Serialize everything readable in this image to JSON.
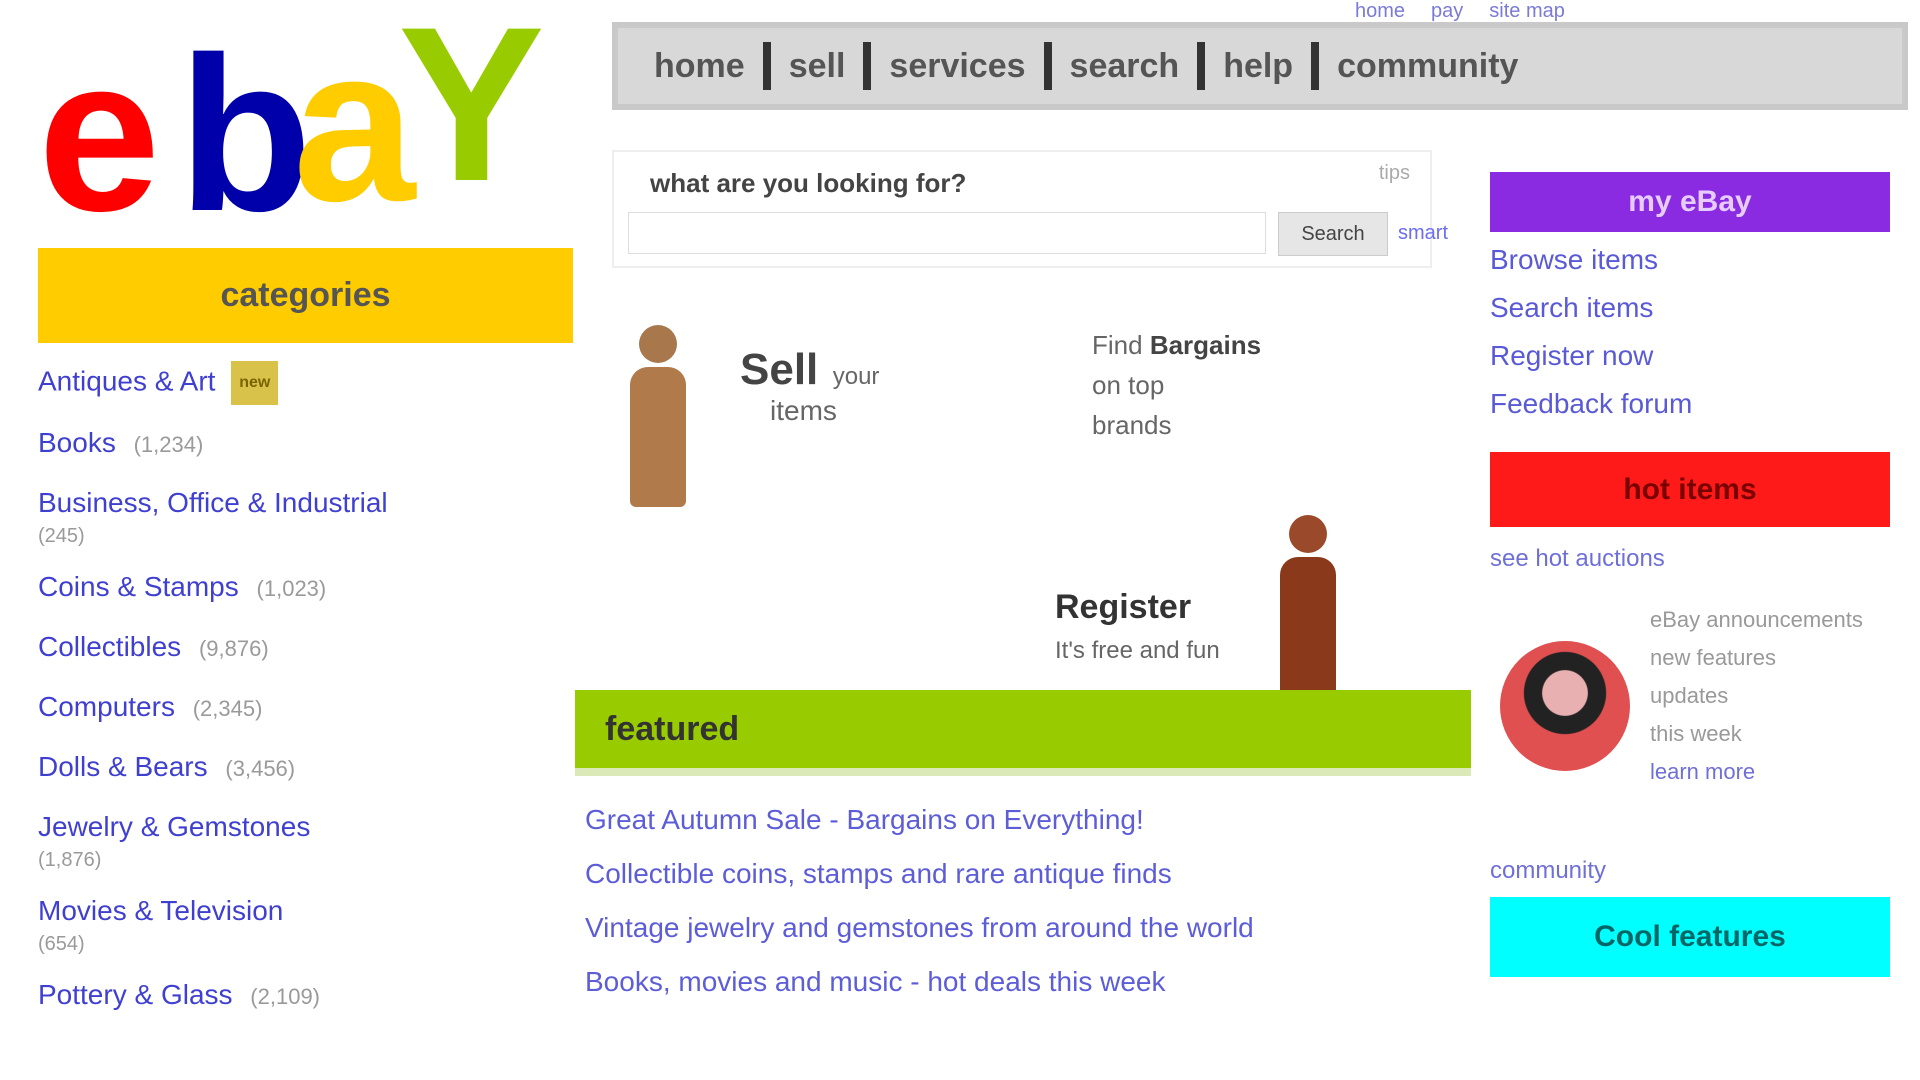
{
  "brand": {
    "logo_text": "ebay"
  },
  "utility_links": [
    "home",
    "pay",
    "site map"
  ],
  "nav": {
    "items": [
      "home",
      "sell",
      "services",
      "search",
      "help",
      "community"
    ]
  },
  "left": {
    "category_header": "categories",
    "categories": [
      {
        "label": "Antiques & Art",
        "badge": "new",
        "count": "",
        "sub": ""
      },
      {
        "label": "Books",
        "badge": "",
        "count": "(1,234)",
        "sub": ""
      },
      {
        "label": "Business, Office & Industrial",
        "badge": "",
        "count": "",
        "sub": "(245)"
      },
      {
        "label": "Coins & Stamps",
        "badge": "",
        "count": "(1,023)",
        "sub": ""
      },
      {
        "label": "Collectibles",
        "badge": "",
        "count": "(9,876)",
        "sub": ""
      },
      {
        "label": "Computers",
        "badge": "",
        "count": "(2,345)",
        "sub": ""
      },
      {
        "label": "Dolls & Bears",
        "badge": "",
        "count": "(3,456)",
        "sub": ""
      },
      {
        "label": "Jewelry & Gemstones",
        "badge": "",
        "count": "",
        "sub": "(1,876)"
      },
      {
        "label": "Movies & Television",
        "badge": "",
        "count": "",
        "sub": "(654)"
      },
      {
        "label": "Pottery & Glass",
        "badge": "",
        "count": "(2,109)",
        "sub": ""
      }
    ]
  },
  "search": {
    "label": "what are you looking for?",
    "help": "tips",
    "placeholder": "",
    "button": "Search",
    "advanced": "smart"
  },
  "promo": {
    "p1_title": "Sell",
    "p1_aside": "your",
    "p1_sub": "items",
    "p2_line1": "Find",
    "p2_bold1": "Bargains",
    "p2_line2": "on top",
    "p2_line3": "brands",
    "p3_title": "Register",
    "p3_sub": "It's free and fun"
  },
  "featured": {
    "header": "featured",
    "links": [
      "Great Autumn Sale - Bargains on Everything!",
      "Collectible coins, stamps and rare antique finds",
      "Vintage jewelry and gemstones from around the world",
      "Books, movies and music - hot deals this week"
    ]
  },
  "right": {
    "purple_header": "my eBay",
    "purple_links": [
      "Browse items",
      "Search items",
      "Register now",
      "Feedback forum"
    ],
    "red_header": "hot items",
    "red_link": "see hot auctions",
    "announce_lines": [
      "eBay announcements",
      "new features",
      "updates",
      "this week"
    ],
    "announce_link": "learn more",
    "more_link": "community",
    "cyan_header": "Cool features"
  },
  "colors": {
    "logo_e": "#ff0000",
    "logo_b": "#0000aa",
    "logo_a": "#ffcc00",
    "logo_y": "#99cc00",
    "categories": "#ffcc00",
    "featured": "#99cc00",
    "purple": "#8a2be2",
    "red": "#ff1a1a",
    "cyan": "#00ffff"
  }
}
